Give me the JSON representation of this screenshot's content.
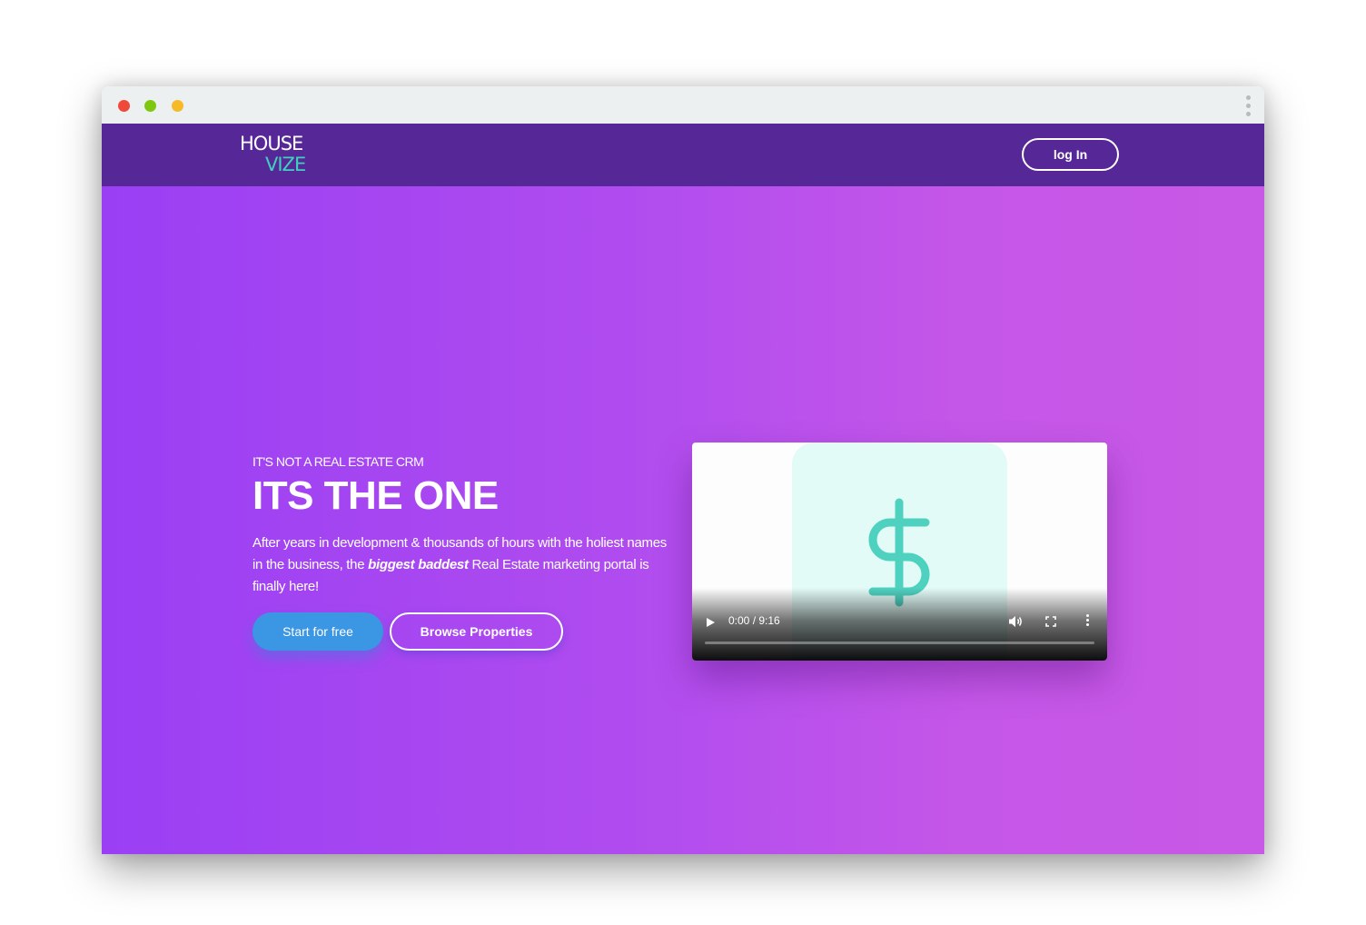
{
  "window": {
    "controls": [
      "close",
      "minimize",
      "maximize"
    ]
  },
  "brand": {
    "line1": "HOUSE",
    "line2": "VIZE",
    "colors": {
      "primary": "#562796",
      "accent": "#3fd1bd"
    }
  },
  "nav": {
    "login_label": "log In"
  },
  "hero": {
    "eyebrow": "IT'S NOT A REAL ESTATE CRM",
    "headline": "ITS THE ONE",
    "desc_part1": "After years in development & thousands of hours with the holiest names in the business, the ",
    "desc_emphasis": "biggest baddest",
    "desc_part2": " Real Estate marketing portal is finally here!",
    "cta_primary": "Start for free",
    "cta_secondary": "Browse Properties"
  },
  "video": {
    "thumbnail_icon": "dollar-sign-icon",
    "time_display": "0:00 / 9:16",
    "progress": 0
  }
}
